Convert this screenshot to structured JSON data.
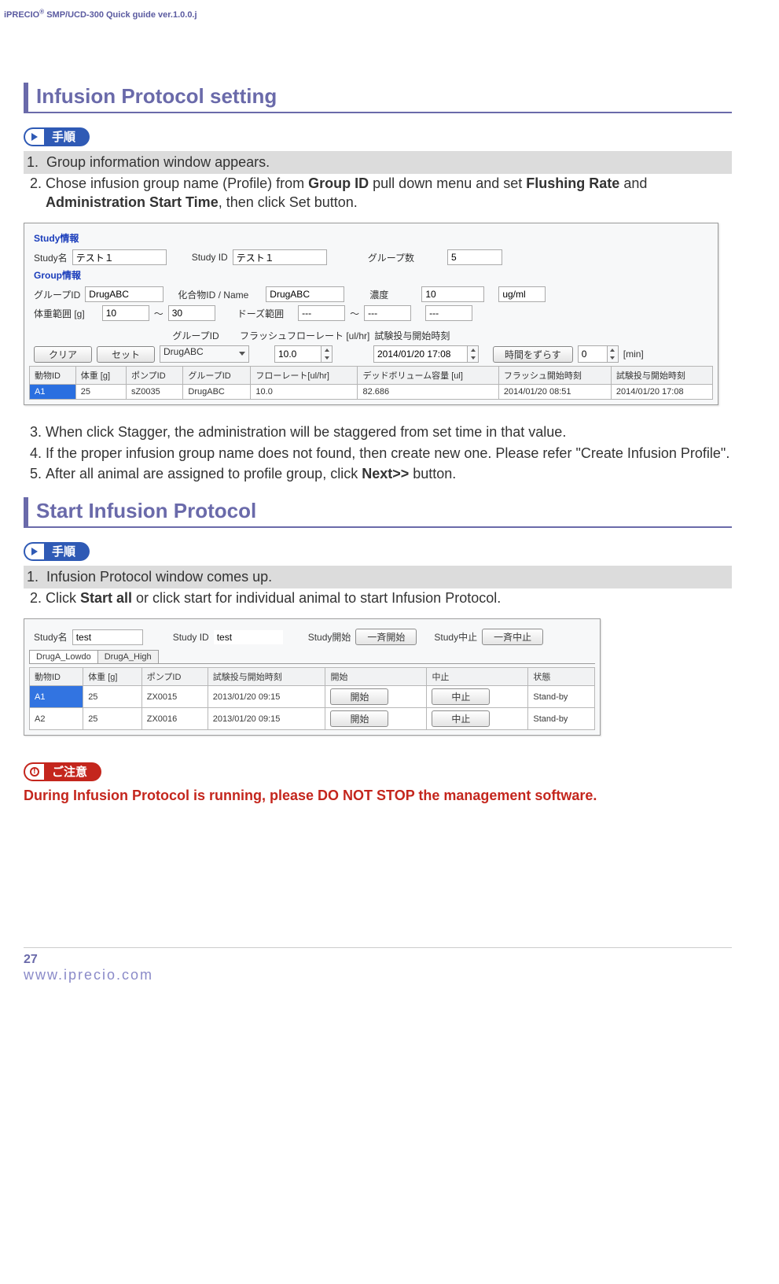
{
  "header": {
    "product": "iPRECIO",
    "sup": "®",
    "rest": " SMP/UCD-300 Quick guide ver.1.0.0.j"
  },
  "section1": {
    "title": "Infusion Protocol setting",
    "badge": "手順",
    "step1": "Group information window appears.",
    "step2_pre": "Chose infusion group name (Profile) from ",
    "step2_b1": "Group ID",
    "step2_mid": " pull down menu and set ",
    "step2_b2": "Flushing Rate",
    "step2_and": " and ",
    "step2_b3": "Administration Start Time",
    "step2_post": ", then click Set button.",
    "step3": "When click Stagger, the administration will be staggered from set time in that value.",
    "step4_pre": "If the proper infusion group name ",
    "step4_mid": "does not found, then create new one. Please refer \"Create Infusion Profile\".",
    "step5_pre": "After all animal are assigned to profile group, click ",
    "step5_b": "Next>>",
    "step5_post": " button."
  },
  "shot1": {
    "study_legend": "Study情報",
    "study_name_label": "Study名",
    "study_name": "テスト１",
    "study_id_label": "Study ID",
    "study_id": "テスト１",
    "group_count_label": "グループ数",
    "group_count": "5",
    "group_legend": "Group情報",
    "gid_label": "グループID",
    "gid": "DrugABC",
    "compound_label": "化合物ID / Name",
    "compound": "DrugABC",
    "conc_label": "濃度",
    "conc": "10",
    "conc_unit": "ug/ml",
    "weight_label": "体重範囲 [g]",
    "w_lo": "10",
    "tilde": "～",
    "w_hi": "30",
    "dose_label": "ドーズ範囲",
    "dash": "---",
    "gid2_label": "グループID",
    "flush_label": "フラッシュフローレート [ul/hr]",
    "admin_label": "試験投与開始時刻",
    "clear_btn": "クリア",
    "set_btn": "セット",
    "dropdown_val": "DrugABC",
    "flush_val": "10.0",
    "admin_val": "2014/01/20 17:08",
    "stagger_btn": "時間をずらす",
    "stagger_val": "0",
    "stagger_unit": "[min]",
    "cols": {
      "c1": "動物ID",
      "c2": "体重 [g]",
      "c3": "ポンプID",
      "c4": "グループID",
      "c5": "フローレート[ul/hr]",
      "c6": "デッドボリューム容量 [ul]",
      "c7": "フラッシュ開始時刻",
      "c8": "試験投与開始時刻"
    },
    "row": {
      "c1": "A1",
      "c2": "25",
      "c3": "sZ0035",
      "c4": "DrugABC",
      "c5": "10.0",
      "c6": "82.686",
      "c7": "2014/01/20 08:51",
      "c8": "2014/01/20 17:08"
    }
  },
  "section2": {
    "title": "Start Infusion Protocol",
    "badge": "手順",
    "step1": "Infusion Protocol window comes up.",
    "step2_pre": "Click ",
    "step2_b": "Start all",
    "step2_post": " or click start for individual animal to start Infusion Protocol."
  },
  "shot2": {
    "study_name_label": "Study名",
    "study_name": "test",
    "study_id_label": "Study ID",
    "study_id": "test",
    "start_label": "Study開始",
    "start_btn": "一斉開始",
    "stop_label": "Study中止",
    "stop_btn": "一斉中止",
    "tab1": "DrugA_Lowdo",
    "tab2": "DrugA_High",
    "cols": {
      "c1": "動物ID",
      "c2": "体重 [g]",
      "c3": "ポンプID",
      "c4": "試験投与開始時刻",
      "c5": "開始",
      "c6": "中止",
      "c7": "状態"
    },
    "r1": {
      "c1": "A1",
      "c2": "25",
      "c3": "ZX0015",
      "c4": "2013/01/20 09:15",
      "c5": "開始",
      "c6": "中止",
      "c7": "Stand-by"
    },
    "r2": {
      "c1": "A2",
      "c2": "25",
      "c3": "ZX0016",
      "c4": "2013/01/20 09:15",
      "c5": "開始",
      "c6": "中止",
      "c7": "Stand-by"
    }
  },
  "warning": {
    "badge": "ご注意",
    "text": "During Infusion Protocol is running, please DO NOT STOP the management software."
  },
  "footer": {
    "num": "27",
    "url": "www.iprecio.com"
  }
}
